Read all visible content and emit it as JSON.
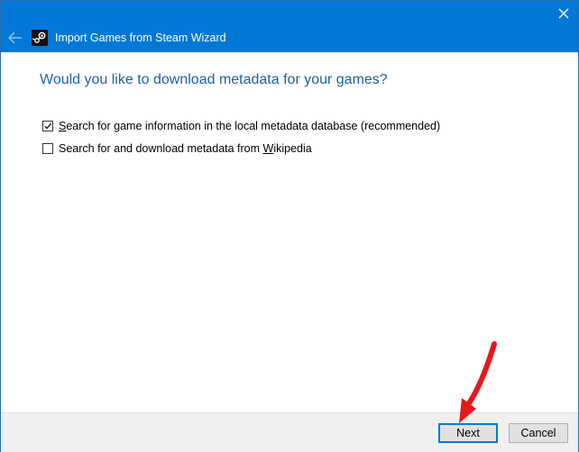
{
  "window": {
    "title": "Import Games from Steam Wizard",
    "icons": [
      "back-arrow-icon",
      "steam-icon",
      "close-icon"
    ]
  },
  "content": {
    "heading": "Would you like to download metadata for your games?",
    "options": [
      {
        "label_pre": "",
        "label_ul": "S",
        "label_post": "earch for game information in the local metadata database (recommended)",
        "checked": true
      },
      {
        "label_pre": "Search for and download metadata from ",
        "label_ul": "W",
        "label_post": "ikipedia",
        "checked": false
      }
    ]
  },
  "footer": {
    "next_label": "Next",
    "cancel_label": "Cancel"
  },
  "colors": {
    "titlebar": "#0078d7",
    "heading": "#1f5fa6",
    "annotation_arrow": "#e8171c"
  }
}
